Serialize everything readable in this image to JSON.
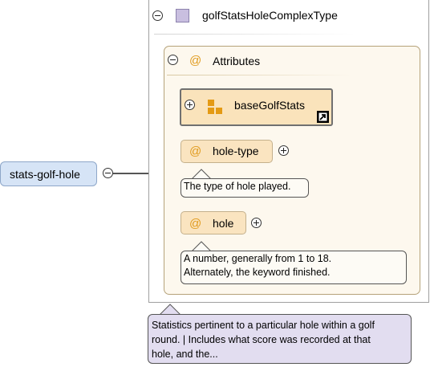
{
  "root_element": {
    "label": "stats-golf-hole"
  },
  "complex_type": {
    "name": "golfStatsHoleComplexType"
  },
  "attributes_group": {
    "label": "Attributes",
    "at_symbol": "@",
    "group_ref": {
      "name": "baseGolfStats"
    },
    "attributes": [
      {
        "name": "hole-type",
        "description": "The type of hole played."
      },
      {
        "name": "hole",
        "description_line1": "A number, generally from 1 to 18.",
        "description_line2": "Alternately, the keyword finished."
      }
    ]
  },
  "type_annotation": {
    "line1": "Statistics pertinent to a particular hole within a golf",
    "line2": "round. | Includes what score was recorded at that",
    "line3": "hole, and the..."
  }
}
